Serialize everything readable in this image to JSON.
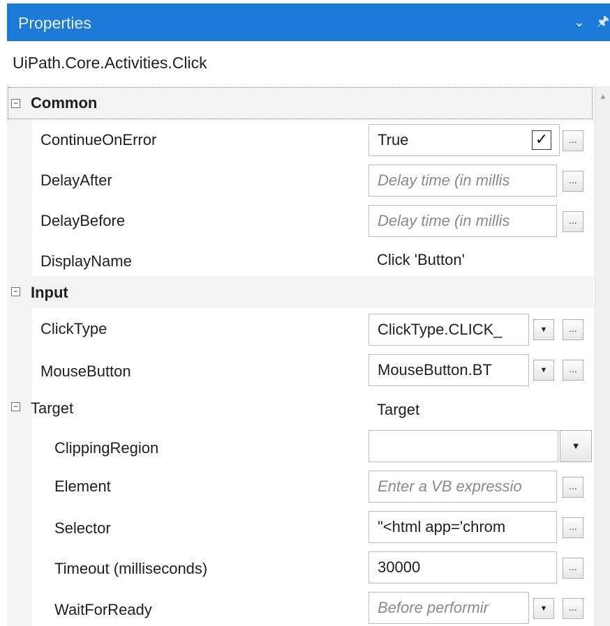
{
  "panel": {
    "title": "Properties",
    "collapse_glyph": "⌄",
    "pin_glyph": "🖈",
    "activity_type": "UiPath.Core.Activities.Click"
  },
  "categories": {
    "common": "Common",
    "input": "Input",
    "target": "Target"
  },
  "toggle_glyph": "−",
  "ellipsis": "...",
  "dropdown_glyph": "▼",
  "check_glyph": "✓",
  "scroll_up_glyph": "▲",
  "properties": {
    "continue_on_error": {
      "name": "ContinueOnError",
      "value": "True"
    },
    "delay_after": {
      "name": "DelayAfter",
      "placeholder": "Delay time (in millis"
    },
    "delay_before": {
      "name": "DelayBefore",
      "placeholder": "Delay time (in millis"
    },
    "display_name": {
      "name": "DisplayName",
      "value": "Click 'Button'"
    },
    "click_type": {
      "name": "ClickType",
      "value": "ClickType.CLICK_"
    },
    "mouse_button": {
      "name": "MouseButton",
      "value": "MouseButton.BT"
    },
    "target": {
      "value": "Target"
    },
    "clipping_region": {
      "name": "ClippingRegion",
      "value": ""
    },
    "element": {
      "name": "Element",
      "placeholder": "Enter a VB expressio"
    },
    "selector": {
      "name": "Selector",
      "value": "\"<html app='chrom"
    },
    "timeout": {
      "name": "Timeout (milliseconds)",
      "value": "30000"
    },
    "wait_for_ready": {
      "name": "WaitForReady",
      "placeholder": "Before performir"
    }
  },
  "colors": {
    "titlebar": "#1c7ad8",
    "category_bg": "#f3f3f3",
    "placeholder": "#8a8a8a"
  }
}
